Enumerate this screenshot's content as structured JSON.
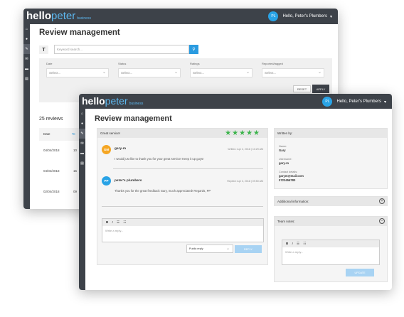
{
  "brand": {
    "hello": "hello",
    "peter": "peter",
    "business": "business"
  },
  "user": {
    "initials": "PL",
    "greeting": "Hello, Peter's Plumbers"
  },
  "page_title": "Review management",
  "back": {
    "search_placeholder": "Keyword search...",
    "filters": [
      {
        "label": "Date",
        "value": "Select..."
      },
      {
        "label": "Status",
        "value": "Select..."
      },
      {
        "label": "Ratings",
        "value": "Select..."
      },
      {
        "label": "Reported/tagged",
        "value": "Select..."
      }
    ],
    "reset": "RESET",
    "apply": "APPLY",
    "reviews_count": "25 reviews",
    "table": {
      "date_header": "Date",
      "dates": [
        "04/04/2018",
        "04/04/2018",
        "02/04/2018"
      ],
      "partial": [
        "10",
        "15",
        "09"
      ],
      "header_partial": "Te"
    }
  },
  "review": {
    "title": "Great service!",
    "stars": 5,
    "comments": [
      {
        "initials": "GM",
        "name": "gary-m",
        "meta": "Written: Apr 2, 2018 | 10:29 AM",
        "text": "I would just like to thank you for your great service! Keep it up guys!",
        "color": "#f5a623"
      },
      {
        "initials": "PP",
        "name": "peter's plumbers",
        "meta": "Replied: Apr 3, 2018 | 09:50 AM",
        "text": "Thanks you for the great feedback Gary, much appreciated! Regards, PP",
        "color": "#29a3e6"
      }
    ],
    "editor_placeholder": "Write a reply...",
    "visibility": "Public reply",
    "reply_button": "REPLY"
  },
  "written_by": {
    "header": "Written by:",
    "name_label": "Name:",
    "name": "Gary",
    "username_label": "Username:",
    "username": "gary-m",
    "contact_label": "Contact details:",
    "email": "garym@mail.com",
    "phone": "0723456780"
  },
  "additional_info": {
    "header": "Additional information:"
  },
  "team_notes": {
    "header": "Team notes:",
    "editor_placeholder": "Write a reply...",
    "update_button": "UPDATE"
  },
  "toolbar": {
    "bold": "B",
    "italic": "I",
    "ulist": "☰",
    "olist": "☷"
  }
}
